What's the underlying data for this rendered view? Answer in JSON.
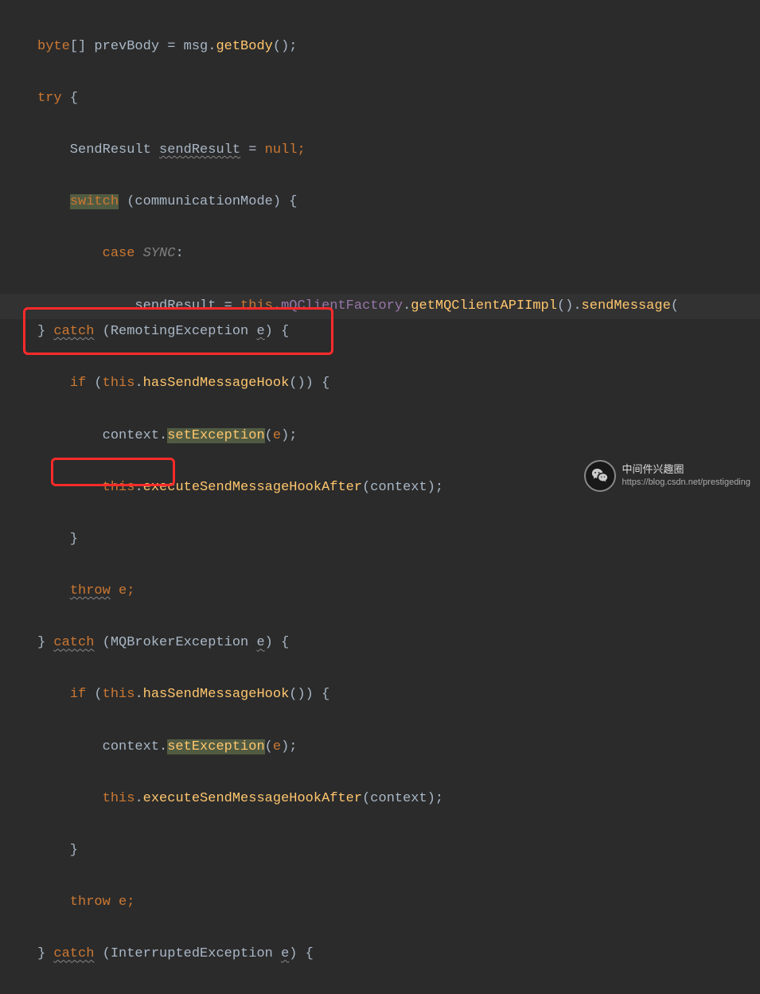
{
  "code": {
    "l1_byte": "byte",
    "l1_arr": "[] prevBody = msg.",
    "l1_getbody": "getBody",
    "l1_end": "();",
    "l2_try": "try",
    "l2_brace": " {",
    "l3_pre": "    SendResult ",
    "l3_sendres": "sendResult",
    "l3_eq": " = ",
    "l3_null": "null",
    "l3_semi": ";",
    "l4_pad": "    ",
    "l4_switch": "switch",
    "l4_rest": " (communicationMode) {",
    "l5_pad": "        ",
    "l5_case": "case",
    "l5_sync": " SYNC",
    "l5_colon": ":",
    "l6_pre": "            sendResult = ",
    "l6_this": "this",
    "l6_dot1": ".",
    "l6_mq": "mQClientFactory",
    "l6_dot2": ".",
    "l6_getapi": "getMQClientAPIImpl",
    "l6_paren": "().",
    "l6_sendmsg": "sendMessage",
    "l6_open": "(",
    "l7_brace": "} ",
    "l7_catch": "catch",
    "l7_open": " (RemotingException ",
    "l7_e": "e",
    "l7_close": ") {",
    "l8_pre": "    ",
    "l8_if": "if",
    "l8_open": " (",
    "l8_this": "this",
    "l8_dot": ".",
    "l8_hook": "hasSendMessageHook",
    "l8_end": "()) {",
    "l9_pre": "        context.",
    "l9_setex": "setException",
    "l9_open": "(",
    "l9_e": "e",
    "l9_close": ");",
    "l10_pre": "        ",
    "l10_this": "this",
    "l10_dot": ".",
    "l10_after": "executeSendMessageHookAfter",
    "l10_end": "(context);",
    "l11": "    }",
    "l12_pre": "    ",
    "l12_throw": "throw",
    "l12_sp": " ",
    "l12_e": "e",
    "l12_semi": ";",
    "l13_brace": "} ",
    "l13_catch": "catch",
    "l13_open": " (MQBrokerException ",
    "l13_e": "e",
    "l13_close": ") {",
    "l14_pre": "    ",
    "l14_if": "if",
    "l14_open": " (",
    "l14_this": "this",
    "l14_dot": ".",
    "l14_hook": "hasSendMessageHook",
    "l14_end": "()) {",
    "l15_pre": "        context.",
    "l15_setex": "setException",
    "l15_open": "(",
    "l15_e": "e",
    "l15_close": ");",
    "l16_pre": "        ",
    "l16_this": "this",
    "l16_dot": ".",
    "l16_after": "executeSendMessageHookAfter",
    "l16_end": "(context);",
    "l17": "    }",
    "l18_pre": "    ",
    "l18_throw": "throw",
    "l18_sp": " ",
    "l18_e": "e",
    "l18_semi": ";",
    "l19_brace": "} ",
    "l19_catch": "catch",
    "l19_open": " (InterruptedException ",
    "l19_e": "e",
    "l19_close": ") {"
  },
  "watermark": {
    "title": "中间件兴趣圈",
    "url": "https://blog.csdn.net/prestigeding"
  }
}
